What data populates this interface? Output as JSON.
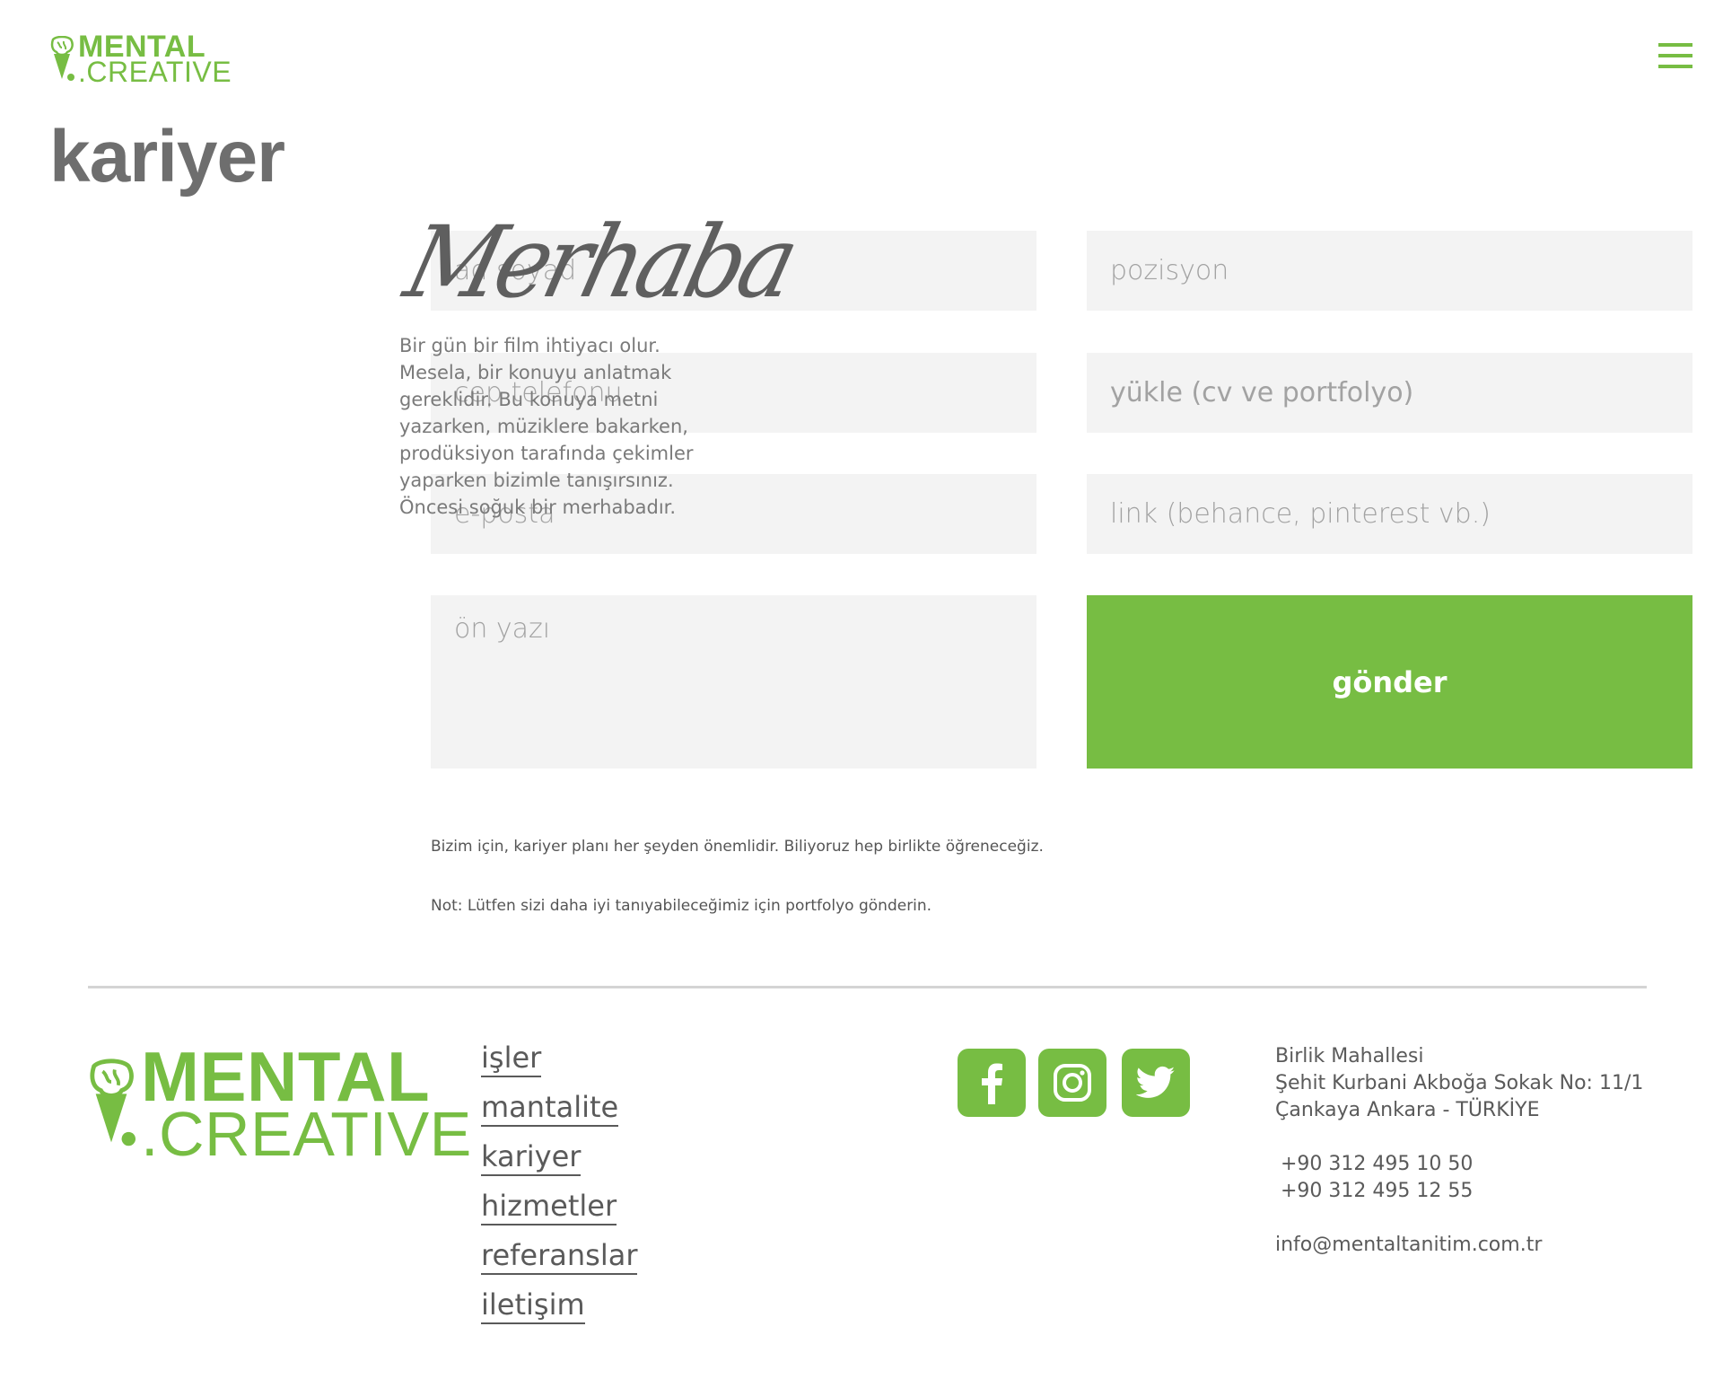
{
  "header": {
    "logo_word1": "MENTAL",
    "logo_word2": ".CREATIVE",
    "menu_icon": "hamburger-menu-icon"
  },
  "page": {
    "title": "kariyer"
  },
  "intro": {
    "script_heading": "Merhaba",
    "text": "Bir gün bir film ihtiyacı olur. Mesela, bir konuyu anlatmak gereklidir. Bu konuya metni yazarken, müziklere bakarken, prodüksiyon tarafında çekimler yaparken bizimle tanışırsınız. Öncesi soğuk bir merhabadır."
  },
  "form": {
    "name_placeholder": "ad soyad",
    "phone_placeholder": "cep telefonu",
    "email_placeholder": "e-posta",
    "cover_placeholder": "ön yazı",
    "position_placeholder": "pozisyon",
    "upload_label": "yükle (cv ve portfolyo)",
    "link_placeholder": "link (behance, pinterest vb.)",
    "submit_label": "gönder"
  },
  "notes": {
    "line1": "Bizim için, kariyer planı her şeyden önemlidir. Biliyoruz hep birlikte öğreneceğiz.",
    "line2": "Not: Lütfen sizi daha iyi tanıyabileceğimiz için portfolyo gönderin."
  },
  "footer": {
    "logo_word1": "MENTAL",
    "logo_word2": ".CREATIVE",
    "nav": [
      "işler",
      "mantalite",
      "kariyer",
      "hizmetler",
      "referanslar",
      "iletişim"
    ],
    "social": [
      "facebook-icon",
      "instagram-icon",
      "twitter-icon"
    ],
    "address": [
      "Birlik Mahallesi",
      "Şehit Kurbani Akboğa Sokak No: 11/1",
      "Çankaya Ankara - TÜRKİYE"
    ],
    "phones": [
      "+90 312 495 10 50",
      "+90 312 495 12 55"
    ],
    "email": "info@mentaltanitim.com.tr"
  },
  "colors": {
    "accent": "#77bd43",
    "field_bg": "#f3f3f3",
    "title": "#6e6e6e"
  }
}
